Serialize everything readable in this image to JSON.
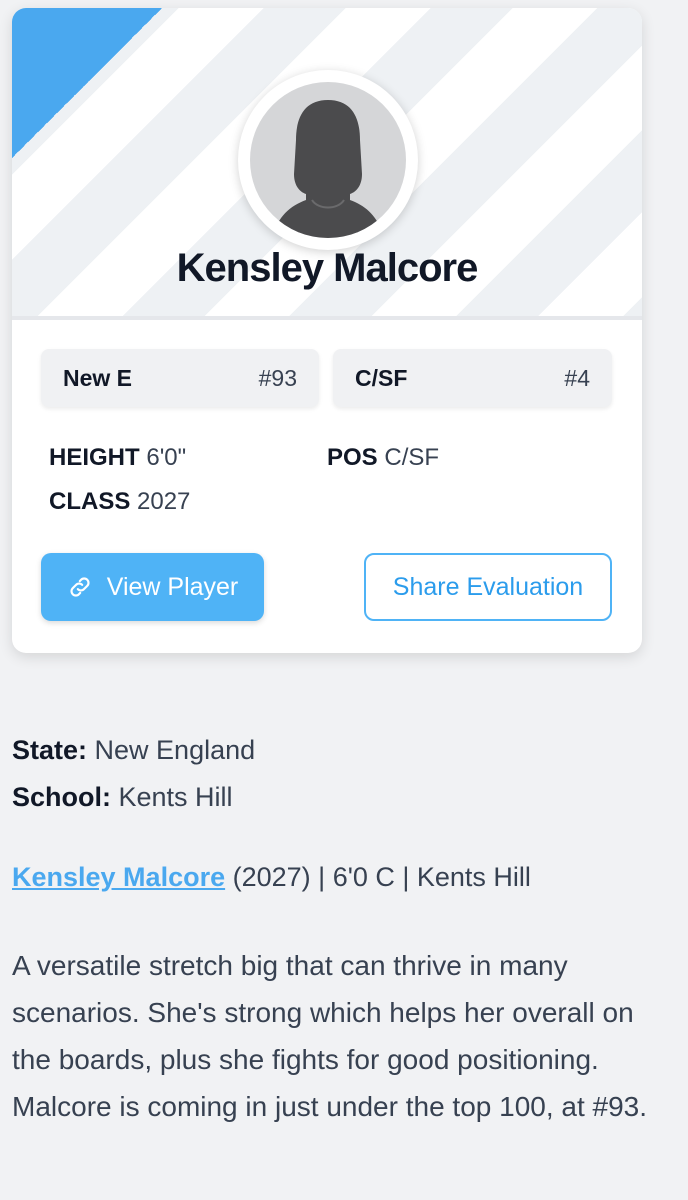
{
  "player": {
    "name": "Kensley Malcore"
  },
  "badges": {
    "team": {
      "label": "New E",
      "rank": "#93"
    },
    "position": {
      "label": "C/SF",
      "rank": "#4"
    }
  },
  "stats": {
    "height_label": "HEIGHT",
    "height_value": "6'0\"",
    "class_label": "CLASS",
    "class_value": "2027",
    "pos_label": "POS",
    "pos_value": "C/SF"
  },
  "buttons": {
    "view_player": "View Player",
    "share_evaluation": "Share Evaluation"
  },
  "details": {
    "state_label": "State:",
    "state_value": "New England",
    "school_label": "School:",
    "school_value": "Kents Hill"
  },
  "headline": {
    "link_text": "Kensley Malcore",
    "rest": "(2027) | 6'0 C | Kents Hill"
  },
  "evaluation": "A versatile stretch big that can thrive in many scenarios. She's strong which helps her overall on the boards, plus she fights for good positioning. Malcore is coming in just under the top 100, at #93.",
  "colors": {
    "accent": "#4fb3f6",
    "ribbon": "#4aa8ef",
    "link": "#4aa8ef"
  },
  "icons": {
    "avatar": "avatar-silhouette-icon",
    "view_player": "link-icon"
  }
}
